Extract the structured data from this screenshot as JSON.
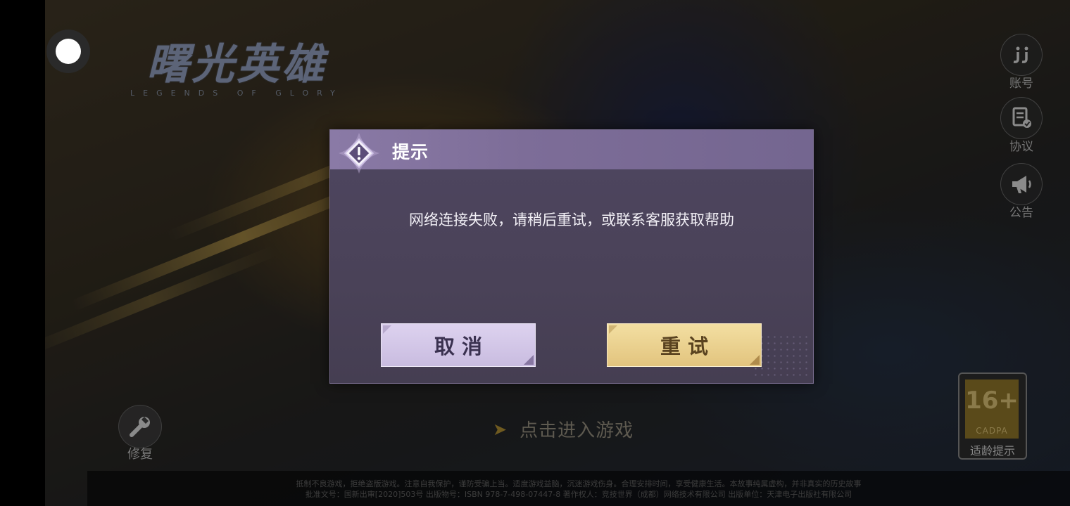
{
  "logo": {
    "title": "曙光英雄",
    "subtitle": "LEGENDS OF GLORY"
  },
  "side_menu": [
    {
      "label": "账号",
      "icon": "account-icon"
    },
    {
      "label": "协议",
      "icon": "agreement-icon"
    },
    {
      "label": "公告",
      "icon": "announcement-icon"
    }
  ],
  "repair": {
    "label": "修复",
    "icon": "wrench-icon"
  },
  "enter_game": {
    "label": "点击进入游戏"
  },
  "age_rating": {
    "number": "16+",
    "org": "CADPA",
    "label": "适龄提示"
  },
  "footer": {
    "line1": "抵制不良游戏，拒绝盗版游戏。注意自我保护，谨防受骗上当。适度游戏益脑，沉迷游戏伤身。合理安排时间，享受健康生活。本故事纯属虚构，并非真实的历史故事",
    "line2": "批准文号：国新出审[2020]503号 出版物号：ISBN 978-7-498-07447-8 著作权人：竞技世界（成都）网络技术有限公司 出版单位：天津电子出版社有限公司"
  },
  "dialog": {
    "title": "提示",
    "message": "网络连接失败，请稍后重试，或联系客服获取帮助",
    "cancel_label": "取消",
    "retry_label": "重试"
  },
  "colors": {
    "dialog_bg": "#4a4258",
    "header_bg": "#8a7aa6",
    "cancel_bg": "#d6caea",
    "retry_bg": "#ecd492"
  }
}
